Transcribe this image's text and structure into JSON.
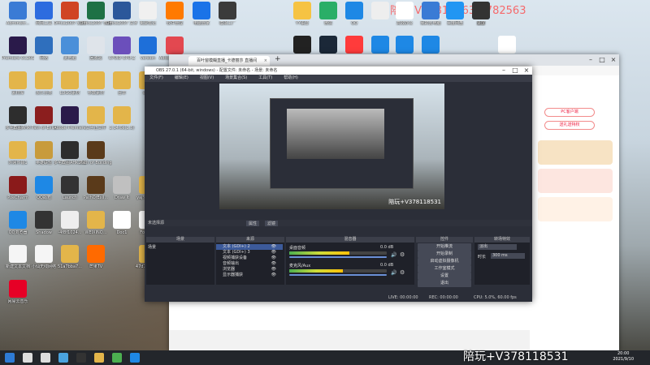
{
  "overlay_text": "陪玩 V37811863 | 782563",
  "watermark": "陪玩+V378118531",
  "clock": {
    "time": "20:00",
    "date": "2021/9/10"
  },
  "desktop_icons_left": [
    {
      "label": "Administr...",
      "color": "#3a7bd5"
    },
    {
      "label": "网网工具",
      "color": "#2d6cdf"
    },
    {
      "label": "Office2007 幻灯片PPT",
      "color": "#d04423"
    },
    {
      "label": "Office2007 表格",
      "color": "#1e7145"
    },
    {
      "label": "Office2007 文字",
      "color": "#2b579a"
    },
    {
      "label": "免费笔记",
      "color": "#f0f0f0"
    },
    {
      "label": "软件管理",
      "color": "#ff7a00"
    },
    {
      "label": "电脑管家",
      "color": "#1a73e8"
    },
    {
      "label": "模拟工厂",
      "color": "#3b3b3b"
    },
    {
      "label": "Premiere CC2019",
      "color": "#2a1a4a"
    },
    {
      "label": "网络",
      "color": "#2f6fbd"
    },
    {
      "label": "此电脑",
      "color": "#4a8fd9"
    },
    {
      "label": "回收站",
      "color": "#dfe4ea"
    },
    {
      "label": "CPUID CPU-Z",
      "color": "#6b4fbb"
    },
    {
      "label": "version",
      "color": "#1e6fd9"
    },
    {
      "label": "Adobe Creative",
      "color": "#e34850"
    },
    {
      "label": "素材库",
      "color": "#e3b54a"
    },
    {
      "label": "永久分类",
      "color": "#e3b54a"
    },
    {
      "label": "LOGO素材",
      "color": "#e3b54a"
    },
    {
      "label": "参数素材",
      "color": "#e3b54a"
    },
    {
      "label": "台本",
      "color": "#e3b54a"
    },
    {
      "label": "error",
      "color": "#e3b54a"
    },
    {
      "label": "多宅截图AHK",
      "color": "#2d2d2d"
    },
    {
      "label": "Path of Exile",
      "color": "#8b1e1e"
    },
    {
      "label": "Adobe Premiere",
      "color": "#2a1a4a"
    },
    {
      "label": "文字正文件",
      "color": "#e3b54a"
    },
    {
      "label": "2.14.0c(1.3)",
      "color": "#e3b54a"
    },
    {
      "label": "外网传输1",
      "color": "#e3b54a"
    },
    {
      "label": "英雄联盟",
      "color": "#c89b3c"
    },
    {
      "label": "多宅截图AHK2019",
      "color": "#2d2d2d"
    },
    {
      "label": "Path of Building",
      "color": "#5a3a1a"
    },
    {
      "label": "PoeCharm",
      "color": "#8a1a1a"
    },
    {
      "label": "QQ邮箱",
      "color": "#1e88e5"
    },
    {
      "label": "Launch",
      "color": "#333333"
    },
    {
      "label": "PathOfExil...",
      "color": "#5a3a1a"
    },
    {
      "label": "Draw It",
      "color": "#c0c0c0"
    },
    {
      "label": "yaj%2Fm...",
      "color": "#e3b54a"
    },
    {
      "label": "QQ浏览器",
      "color": "#1e88e5"
    },
    {
      "label": "Shadow",
      "color": "#333333"
    },
    {
      "label": "-4f8f1024...",
      "color": "#eeeeee"
    },
    {
      "label": "WEIXINQ...",
      "color": "#e3b54a"
    },
    {
      "label": "Doc1",
      "color": "#ffffff"
    },
    {
      "label": "For Hon",
      "color": "#ffffff"
    },
    {
      "label": "新建文本文档",
      "color": "#f5f5f5"
    },
    {
      "label": "小仙无线网络",
      "color": "#f5f5f5"
    },
    {
      "label": "51a7bba7...",
      "color": "#e3b54a"
    },
    {
      "label": "芒果TV",
      "color": "#ff6a00"
    },
    {
      "label": "47d7b487...",
      "color": "#e3b54a"
    },
    {
      "label": "网易云音乐",
      "color": "#e60026"
    }
  ],
  "desktop_icons_top": [
    {
      "label": "YY语音",
      "color": "#f6c343"
    },
    {
      "label": "微信",
      "color": "#2aae67"
    },
    {
      "label": "QQ",
      "color": "#1e88e5"
    },
    {
      "label": "",
      "color": "#eeeeee"
    },
    {
      "label": "高效办公",
      "color": "#ffffff"
    },
    {
      "label": "我的云电脑",
      "color": "#3a7bd5"
    },
    {
      "label": "百度网盘",
      "color": "#2196f3"
    },
    {
      "label": "迅雷",
      "color": "#1e88e5"
    },
    {
      "label": "GG加速器",
      "color": "#222222"
    },
    {
      "label": "Steam",
      "color": "#1b2838"
    },
    {
      "label": "网易UU",
      "color": "#ff3b3b"
    },
    {
      "label": "腾讯会议",
      "color": "#1e88e5"
    },
    {
      "label": "我的云",
      "color": "#1e88e5"
    },
    {
      "label": "百度网盘",
      "color": "#1e88e5"
    },
    {
      "label": "录屏",
      "color": "#333333"
    },
    {
      "label": "闪电",
      "color": "#ffffff"
    }
  ],
  "browser": {
    "tab_title": "百叶窗模糊直播_卡德丽莎 直播间",
    "new_tab": "+",
    "address": "douyu.com"
  },
  "browser_page": {
    "pc_client": "PC客户端",
    "gift": "送礼送特权",
    "follow": "订阅",
    "gifts_label": "礼物"
  },
  "obs": {
    "title": "OBS 27.0.1 (64-bit, windows) - 配置文件: 未命名 - 场景: 未命名",
    "menu": [
      "文件(F)",
      "编辑(E)",
      "视图(V)",
      "场景集合(S)",
      "工具(T)",
      "帮助(H)"
    ],
    "no_source": "未选择源",
    "properties": "属性",
    "filters": "滤镜",
    "panels": {
      "scenes": "场景",
      "sources": "来源",
      "mixer": "混音器",
      "transitions": "转场特效",
      "controls": "控件"
    },
    "scene_item": "场景",
    "sources": [
      "文本 (GDI+) 2",
      "文本 (GDI+) 3",
      "视频捕获设备",
      "音频输出",
      "浏览器",
      "显示器捕获"
    ],
    "mixer": [
      {
        "name": "桌面音频",
        "level": "0.0 dB",
        "fill": 0.62
      },
      {
        "name": "麦克风/Aux",
        "level": "0.0 dB",
        "fill": 0.55
      }
    ],
    "controls": [
      "开始推流",
      "开始录制",
      "启动虚拟摄像机",
      "工作室模式",
      "设置",
      "退出"
    ],
    "transition": {
      "type": "淡出",
      "duration_label": "时长",
      "duration": "300 ms"
    },
    "status": {
      "live": "LIVE: 00:00:00",
      "rec": "REC: 00:00:00",
      "cpu": "CPU: 5.0%, 60.00 fps"
    },
    "preview_overlay": "陪玩+V378118531"
  },
  "taskbar_icons": [
    "start",
    "search",
    "taskview",
    "browser",
    "obs",
    "explorer",
    "chrome",
    "qq"
  ]
}
